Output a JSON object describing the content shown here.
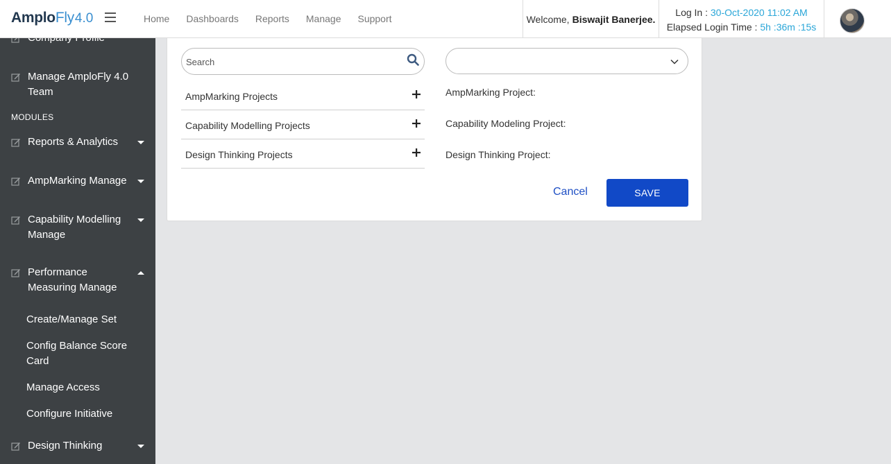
{
  "header": {
    "logo_main": "Amplo",
    "logo_fly": "Fly",
    "logo_version": "4.0",
    "nav": [
      "Home",
      "Dashboards",
      "Reports",
      "Manage",
      "Support"
    ],
    "welcome_prefix": "Welcome,",
    "user_name": "Biswajit Banerjee.",
    "login_label": "Log In :",
    "login_value": "30-Oct-2020 11:02 AM",
    "elapsed_label": "Elapsed Login Time :",
    "elapsed_value": "5h :36m :15s"
  },
  "sidebar": {
    "partial_item": "Company Profile",
    "manage_team": "Manage AmploFly 4.0 Team",
    "modules_heading": "MODULES",
    "items": [
      {
        "label": "Reports & Analytics"
      },
      {
        "label": "AmpMarking Manage"
      },
      {
        "label": "Capability Modelling Manage"
      },
      {
        "label": "Performance Measuring Manage"
      }
    ],
    "subitems": [
      "Create/Manage Set",
      "Config Balance Score Card",
      "Manage Access",
      "Configure Initiative"
    ],
    "design_thinking": "Design Thinking"
  },
  "form": {
    "search_placeholder": "Search",
    "projects": [
      "AmpMarking Projects",
      "Capability Modelling Projects",
      "Design Thinking Projects"
    ],
    "select_value": "",
    "labels": [
      "AmpMarking Project:",
      "Capability Modeling Project:",
      "Design Thinking Project:"
    ],
    "cancel_label": "Cancel",
    "save_label": "SAVE"
  },
  "colors": {
    "sidebar_bg": "#3d4144",
    "primary_button": "#1149c7",
    "link_blue": "#1e4fc4",
    "accent_blue": "#2aa6d8"
  }
}
